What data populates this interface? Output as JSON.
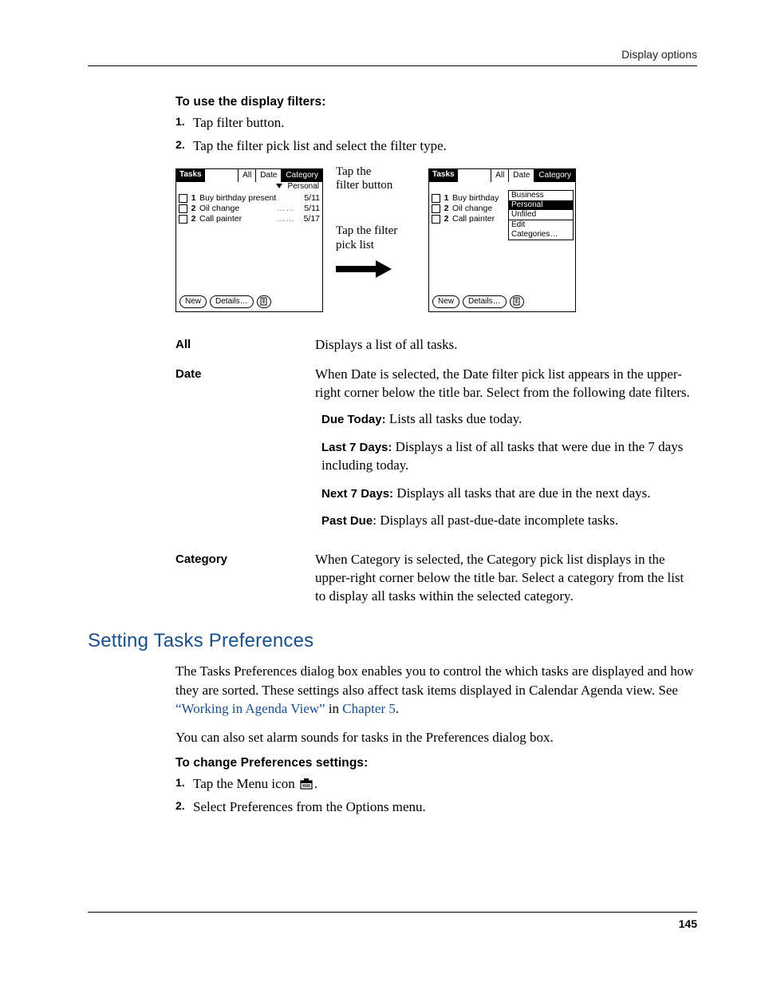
{
  "header": {
    "running": "Display options"
  },
  "instr1": {
    "heading": "To use the display filters:",
    "steps": [
      "Tap filter button.",
      "Tap the filter pick list and select the filter type."
    ]
  },
  "figure": {
    "app_title": "Tasks",
    "tabs": [
      "All",
      "Date",
      "Category"
    ],
    "filter_value": "Personal",
    "tasks": [
      {
        "pri": "1",
        "name": "Buy birthday present",
        "due": "5/11"
      },
      {
        "pri": "2",
        "name": "Oil change",
        "due": "5/11"
      },
      {
        "pri": "2",
        "name": "Call painter",
        "due": "5/17"
      }
    ],
    "buttons": {
      "new": "New",
      "details": "Details…"
    },
    "callouts": {
      "c1a": "Tap the",
      "c1b": "filter button",
      "c2a": "Tap the filter",
      "c2b": "pick list"
    },
    "categories": [
      "Business",
      "Personal",
      "Unfiled",
      "Edit Categories…"
    ]
  },
  "defs": {
    "all": {
      "term": "All",
      "desc": "Displays a list of all tasks."
    },
    "date": {
      "term": "Date",
      "desc": "When Date is selected, the Date filter pick list appears in the upper-right corner below the title bar. Select from the following date filters.",
      "sub": [
        {
          "b": "Due Today:",
          "t": " Lists all tasks due today."
        },
        {
          "b": "Last 7 Days:",
          "t": " Displays a list of all tasks that were due in the 7 days including today."
        },
        {
          "b": "Next 7 Days:",
          "t": " Displays all tasks that are due in the next days."
        },
        {
          "b": "Past Due",
          "colon": ": ",
          "t": "Displays all past-due-date incomplete tasks."
        }
      ]
    },
    "category": {
      "term": "Category",
      "desc": "When Category is selected, the Category pick list displays in the upper-right corner below the title bar. Select a category from the list to display all tasks within the selected category."
    }
  },
  "section2": {
    "heading": "Setting Tasks Preferences",
    "p1a": "The Tasks Preferences dialog box enables you to control the which tasks are displayed and how they are sorted. These settings also affect task items displayed in Calendar Agenda view. See ",
    "link1": "“Working in Agenda View”",
    "p1b": " in ",
    "link2": "Chapter 5",
    "p1c": ".",
    "p2": "You can also set alarm sounds for tasks in the Preferences dialog box.",
    "instr_heading": "To change Preferences settings:",
    "step1a": "Tap the Menu icon ",
    "step1b": ".",
    "step2": "Select Preferences from the Options menu."
  },
  "page_number": "145"
}
